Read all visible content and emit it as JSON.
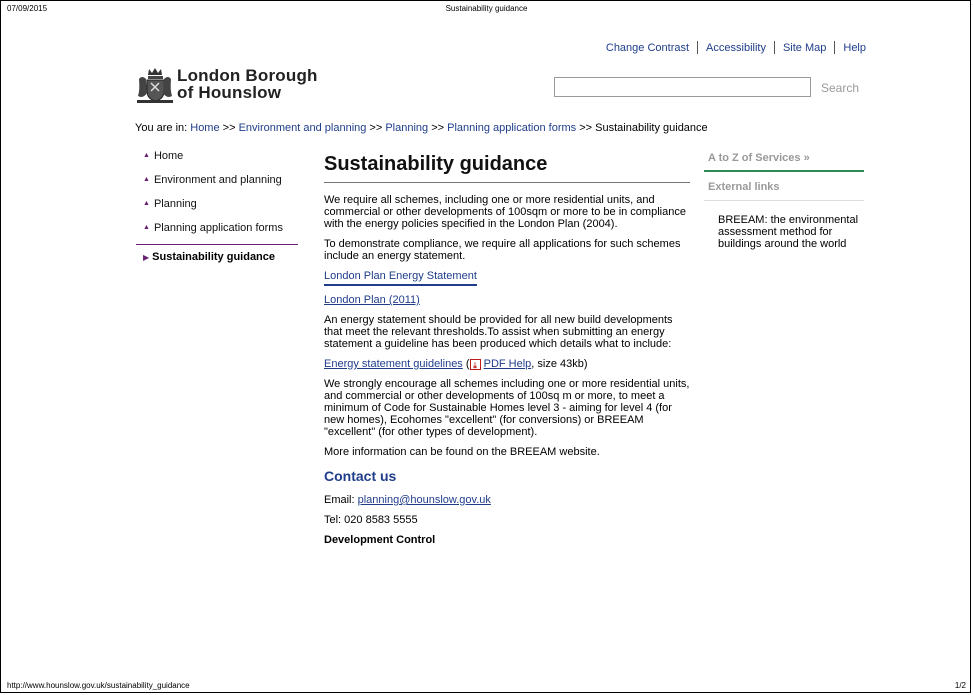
{
  "print": {
    "date": "07/09/2015",
    "title": "Sustainability guidance",
    "url": "http://www.hounslow.gov.uk/sustainability_guidance",
    "page": "1/2"
  },
  "toplinks": [
    "Change Contrast",
    "Accessibility",
    "Site Map",
    "Help"
  ],
  "logo": {
    "line1": "London Borough",
    "line2": "of Hounslow"
  },
  "search": {
    "value": "",
    "button_label": "Search"
  },
  "breadcrumb": {
    "prefix": "You are in: ",
    "items": [
      "Home",
      "Environment and planning",
      "Planning",
      "Planning application forms"
    ],
    "separator": " >> ",
    "current": "Sustainability guidance"
  },
  "nav": {
    "items": [
      "Home",
      "Environment and planning",
      "Planning",
      "Planning application forms"
    ],
    "current": "Sustainability guidance"
  },
  "main": {
    "title": "Sustainability guidance",
    "p1": "We require all schemes, including one or more residential units, and commercial or other developments of 100sqm or more to be in compliance with the energy policies specified in the London Plan (2004).",
    "p2": "To demonstrate compliance, we require all applications for such schemes include an energy statement.",
    "link_energy_statement": "London Plan Energy Statement",
    "link_london_plan": "London Plan (2011)",
    "p3": "An energy statement should be provided for all new build developments that meet the relevant thresholds.To assist when submitting an energy statement a guideline has been produced which details what  to include:",
    "guidelines_link": "Energy statement guidelines",
    "open_paren": " (",
    "pdf_help": "PDF Help",
    "size_text": ", size 43kb)",
    "p4": "We strongly encourage all schemes including one or more residential units, and commercial or other developments of 100sq m or more, to meet a minimum of Code for Sustainable Homes level 3 - aiming for level 4 (for new homes), Ecohomes \"excellent\" (for conversions) or BREEAM \"excellent\" (for other types of development).",
    "p5": "More information can be found on the BREEAM website.",
    "contact_heading": "Contact us",
    "email_label": "Email: ",
    "email": "planning@hounslow.gov.uk",
    "tel": "Tel: 020 8583 5555",
    "dept": "Development Control"
  },
  "right": {
    "az_label": "A to Z of Services »",
    "ext_title": "External links",
    "ext_text": "BREEAM: the environmental assessment method for buildings around the world"
  },
  "colors": {
    "link": "#1f3d8a",
    "nav_accent": "#6a1f70",
    "az_rule": "#2e8b57"
  },
  "icons": [
    "crest-logo-icon",
    "nav-triangle-icon",
    "pdf-icon"
  ]
}
